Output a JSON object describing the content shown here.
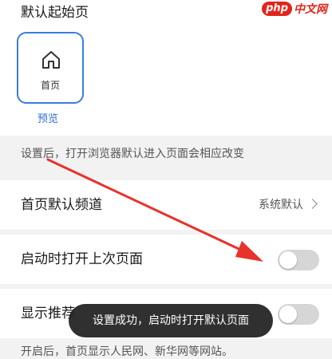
{
  "watermark": {
    "badge": "php",
    "text": "中文网"
  },
  "start_page": {
    "title": "默认起始页",
    "card": {
      "icon": "home-icon",
      "label": "首页"
    },
    "preview_label": "预览"
  },
  "hint_top": "设置后，打开浏览器默认进入页面会相应改变",
  "channel_row": {
    "label": "首页默认频道",
    "value": "系统默认"
  },
  "restore_row": {
    "label": "启动时打开上次页面",
    "toggle_on": false
  },
  "recommend_row": {
    "label": "显示推荐",
    "toggle_on": false
  },
  "hint_bottom": "开启后，首页显示人民网、新华网等网站。",
  "toast": "设置成功，启动时打开默认页面",
  "colors": {
    "accent": "#3a7de0",
    "arrow": "#e8322c",
    "toggle_off": "#d6d6d6"
  }
}
